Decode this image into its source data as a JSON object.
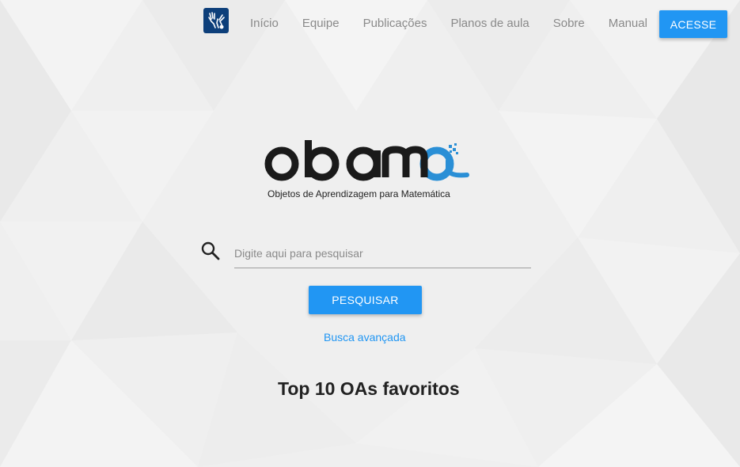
{
  "nav": {
    "logo_icon": "hands-accessibility-icon",
    "links": [
      {
        "label": "Início"
      },
      {
        "label": "Equipe"
      },
      {
        "label": "Publicações"
      },
      {
        "label": "Planos de aula"
      },
      {
        "label": "Sobre"
      },
      {
        "label": "Manual"
      }
    ],
    "cta_label": "ACESSE"
  },
  "brand": {
    "name": "obama",
    "tagline": "Objetos de Aprendizagem para Matemática"
  },
  "search": {
    "placeholder": "Digite aqui para pesquisar",
    "value": "",
    "button_label": "PESQUISAR",
    "advanced_label": "Busca avançada"
  },
  "section": {
    "title": "Top 10 OAs favoritos"
  },
  "colors": {
    "accent": "#2196f3",
    "logo_blue": "#2a8fd6",
    "nav_logo_bg": "#0d3f7a",
    "background": "#efefef"
  }
}
